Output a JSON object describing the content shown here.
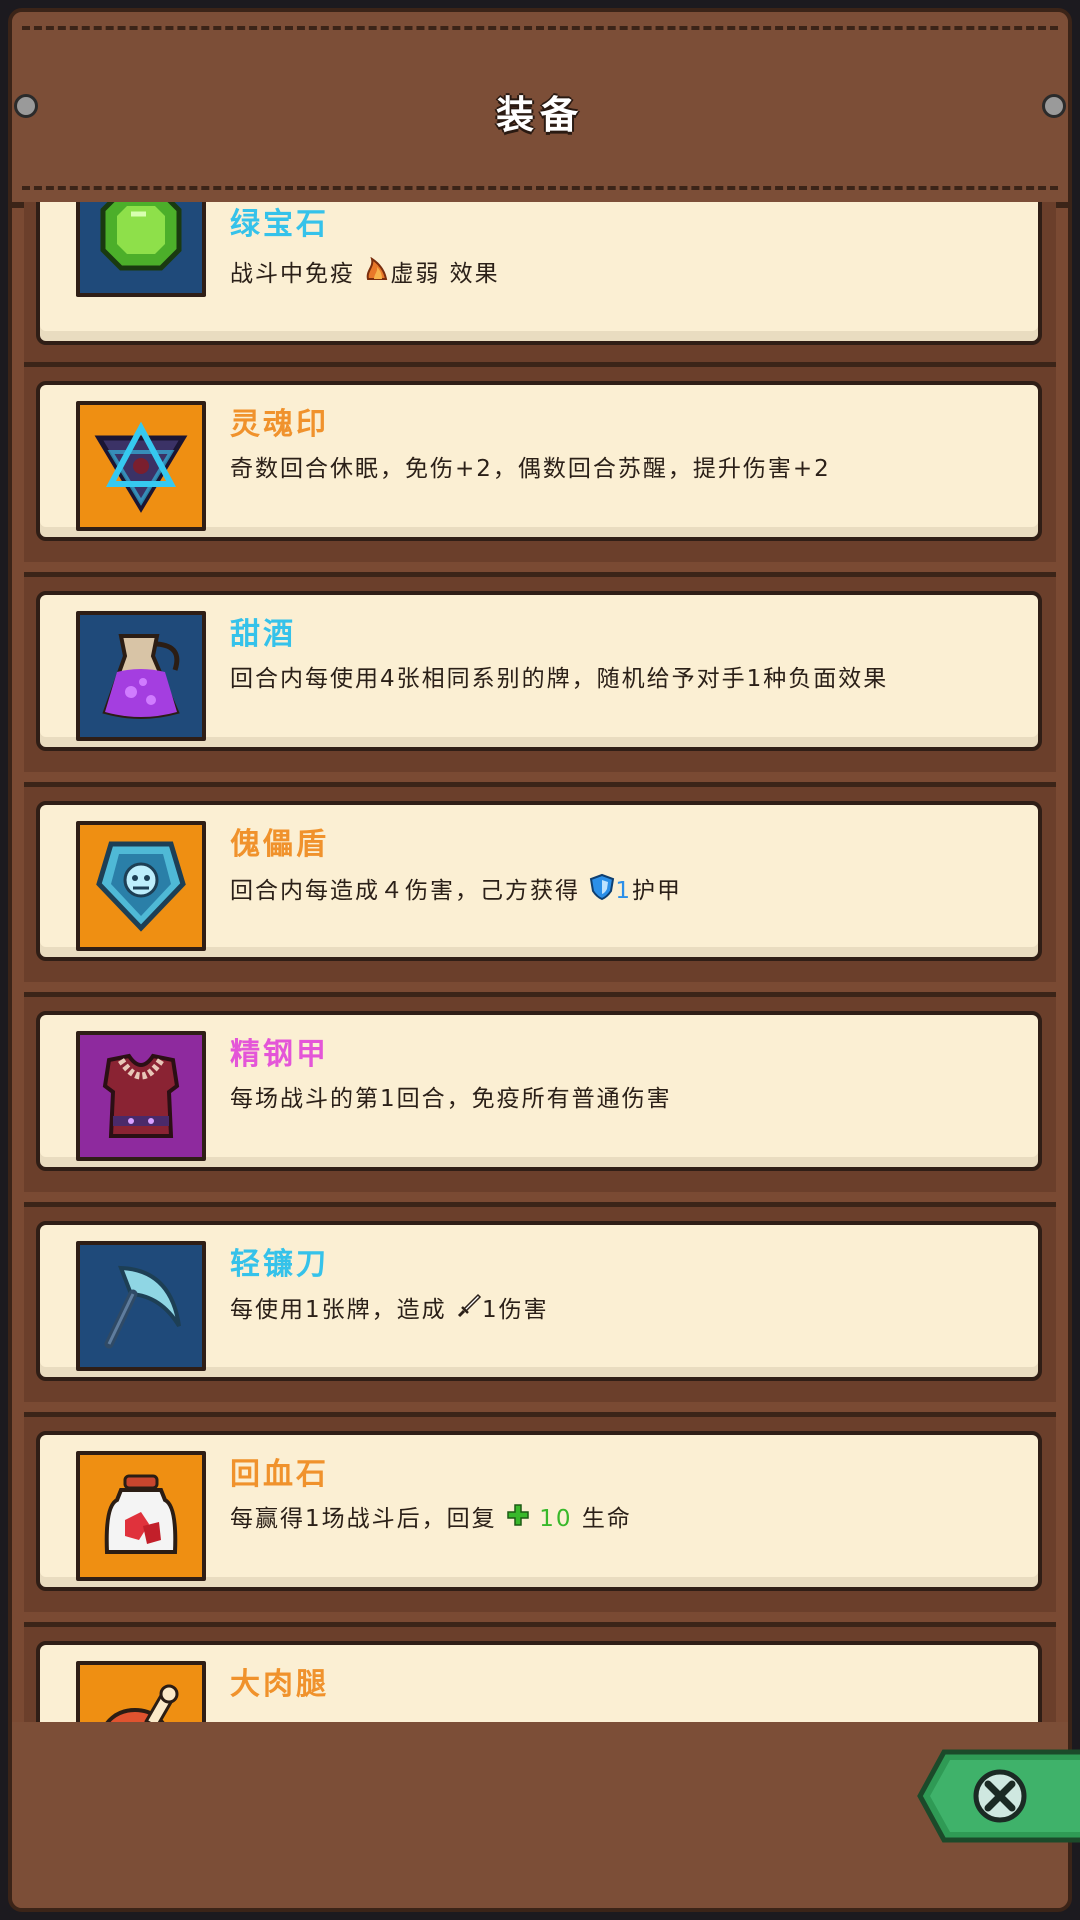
{
  "header": {
    "title": "装备"
  },
  "items": [
    {
      "name": "绿宝石",
      "name_color": "#35c2ea",
      "icon": "green-gem-icon",
      "bg": "#1f4a7a",
      "desc_parts": [
        "战斗中免疫",
        "虚弱",
        "效果"
      ]
    },
    {
      "name": "灵魂印",
      "name_color": "#f0922c",
      "icon": "soul-seal-icon",
      "bg": "#ef8f12",
      "desc": "奇数回合休眠，免伤+2，偶数回合苏醒，提升伤害+2"
    },
    {
      "name": "甜酒",
      "name_color": "#35c2ea",
      "icon": "sweet-wine-jug-icon",
      "bg": "#1f4a7a",
      "desc": "回合内每使用4张相同系别的牌，随机给予对手1种负面效果"
    },
    {
      "name": "傀儡盾",
      "name_color": "#f0922c",
      "icon": "puppet-shield-icon",
      "bg": "#ef8f12",
      "desc_parts": [
        "回合内每造成４伤害，己方获得",
        "1",
        "护甲"
      ]
    },
    {
      "name": "精钢甲",
      "name_color": "#e455d8",
      "icon": "steel-armor-icon",
      "bg": "#8e2a9e",
      "desc": "每场战斗的第1回合，免疫所有普通伤害"
    },
    {
      "name": "轻镰刀",
      "name_color": "#35c2ea",
      "icon": "light-sickle-icon",
      "bg": "#1f4a7a",
      "desc_parts": [
        "每使用1张牌，造成",
        "1伤害"
      ]
    },
    {
      "name": "回血石",
      "name_color": "#f0922c",
      "icon": "healing-stone-jar-icon",
      "bg": "#ef8f12",
      "desc_parts": [
        "每赢得1场战斗后，回复",
        "10",
        "生命"
      ]
    },
    {
      "name": "大肉腿",
      "name_color": "#f0922c",
      "icon": "meat-leg-icon",
      "bg": "#ef8f12"
    }
  ],
  "colors": {
    "heal_green": "#39b82b",
    "armor_blue": "#2b8fe8",
    "weak_orange": "#e8782a"
  }
}
